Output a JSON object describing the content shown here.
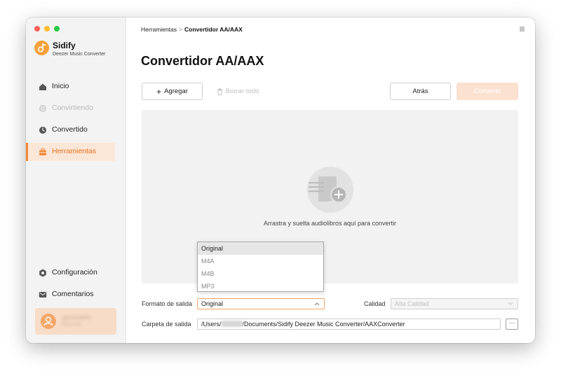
{
  "app": {
    "name": "Sidify",
    "subtitle": "Deezer Music Converter"
  },
  "sidebar": {
    "items": [
      {
        "label": "Inicio",
        "icon": "home-icon",
        "state": "normal"
      },
      {
        "label": "Convirtiendo",
        "icon": "sync-icon",
        "state": "disabled"
      },
      {
        "label": "Convertido",
        "icon": "clock-icon",
        "state": "normal"
      },
      {
        "label": "Herramientas",
        "icon": "toolbox-icon",
        "state": "active"
      }
    ],
    "bottom_items": [
      {
        "label": "Configuración",
        "icon": "gear-icon"
      },
      {
        "label": "Comentarios",
        "icon": "mail-icon"
      }
    ],
    "user": {
      "name": "apuntodefin",
      "email": "ifrilo.com"
    }
  },
  "breadcrumb": {
    "parent": "Herramientas",
    "separator": ">",
    "current": "Convertidor AA/AAX"
  },
  "page": {
    "title": "Convertidor AA/AAX"
  },
  "toolbar": {
    "add_label": "Agregar",
    "clear_label": "Borrar todo",
    "back_label": "Atrás",
    "convert_label": "Convertir"
  },
  "dropzone": {
    "text": "Arrastra y suelta audiolibros aquí para convertir"
  },
  "output": {
    "format_label": "Formato de salida",
    "format_value": "Original",
    "format_options": [
      "Original",
      "M4A",
      "M4B",
      "MP3"
    ],
    "quality_label": "Calidad",
    "quality_value": "Alta Calidad",
    "folder_label": "Carpeta de salida",
    "folder_prefix": "/Users/",
    "folder_suffix": "/Documents/Sidify Deezer Music Converter/AAXConverter",
    "browse_label": "···"
  },
  "colors": {
    "accent": "#f08a3a",
    "active_bg": "#fbe7d8",
    "convert_disabled_bg": "#fbe1d0"
  }
}
